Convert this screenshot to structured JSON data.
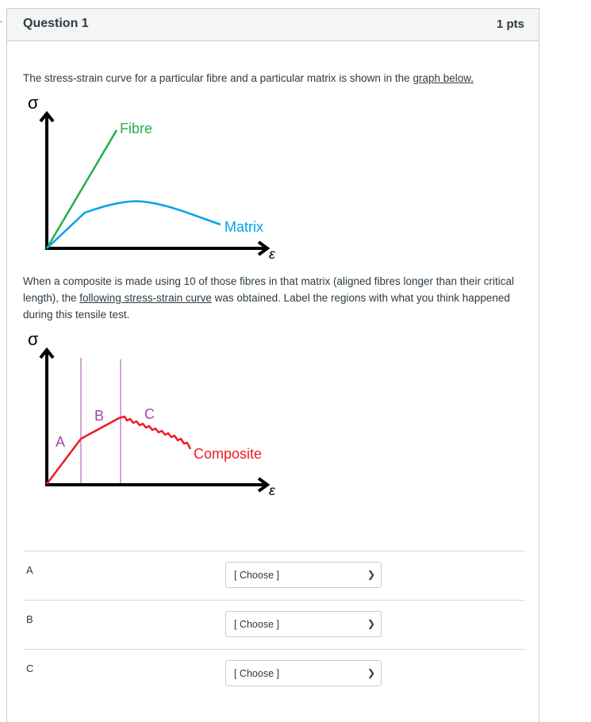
{
  "question": {
    "title": "Question 1",
    "points": "1 pts"
  },
  "intro": {
    "text": "The stress-strain curve for a particular fibre and a particular matrix is shown in the ",
    "link": "graph below."
  },
  "graph1": {
    "y_symbol": "σ",
    "x_symbol": "ε",
    "fibre_label": "Fibre",
    "matrix_label": "Matrix",
    "fibre_color": "#22b14c",
    "matrix_color": "#00a2e8"
  },
  "middle": {
    "text1": "When a composite is made using 10 of those fibres in that matrix (aligned fibres longer than their critical length), the ",
    "link": "following stress-strain curve",
    "text2": " was obtained. Label the regions with what you think happened during this tensile test."
  },
  "graph2": {
    "y_symbol": "σ",
    "x_symbol": "ε",
    "region_labels": [
      "A",
      "B",
      "C"
    ],
    "composite_label": "Composite",
    "curve_color": "#ed1c24",
    "region_color": "#a349a4"
  },
  "answers": [
    {
      "label": "A",
      "selected": "[ Choose ]"
    },
    {
      "label": "B",
      "selected": "[ Choose ]"
    },
    {
      "label": "C",
      "selected": "[ Choose ]"
    }
  ]
}
